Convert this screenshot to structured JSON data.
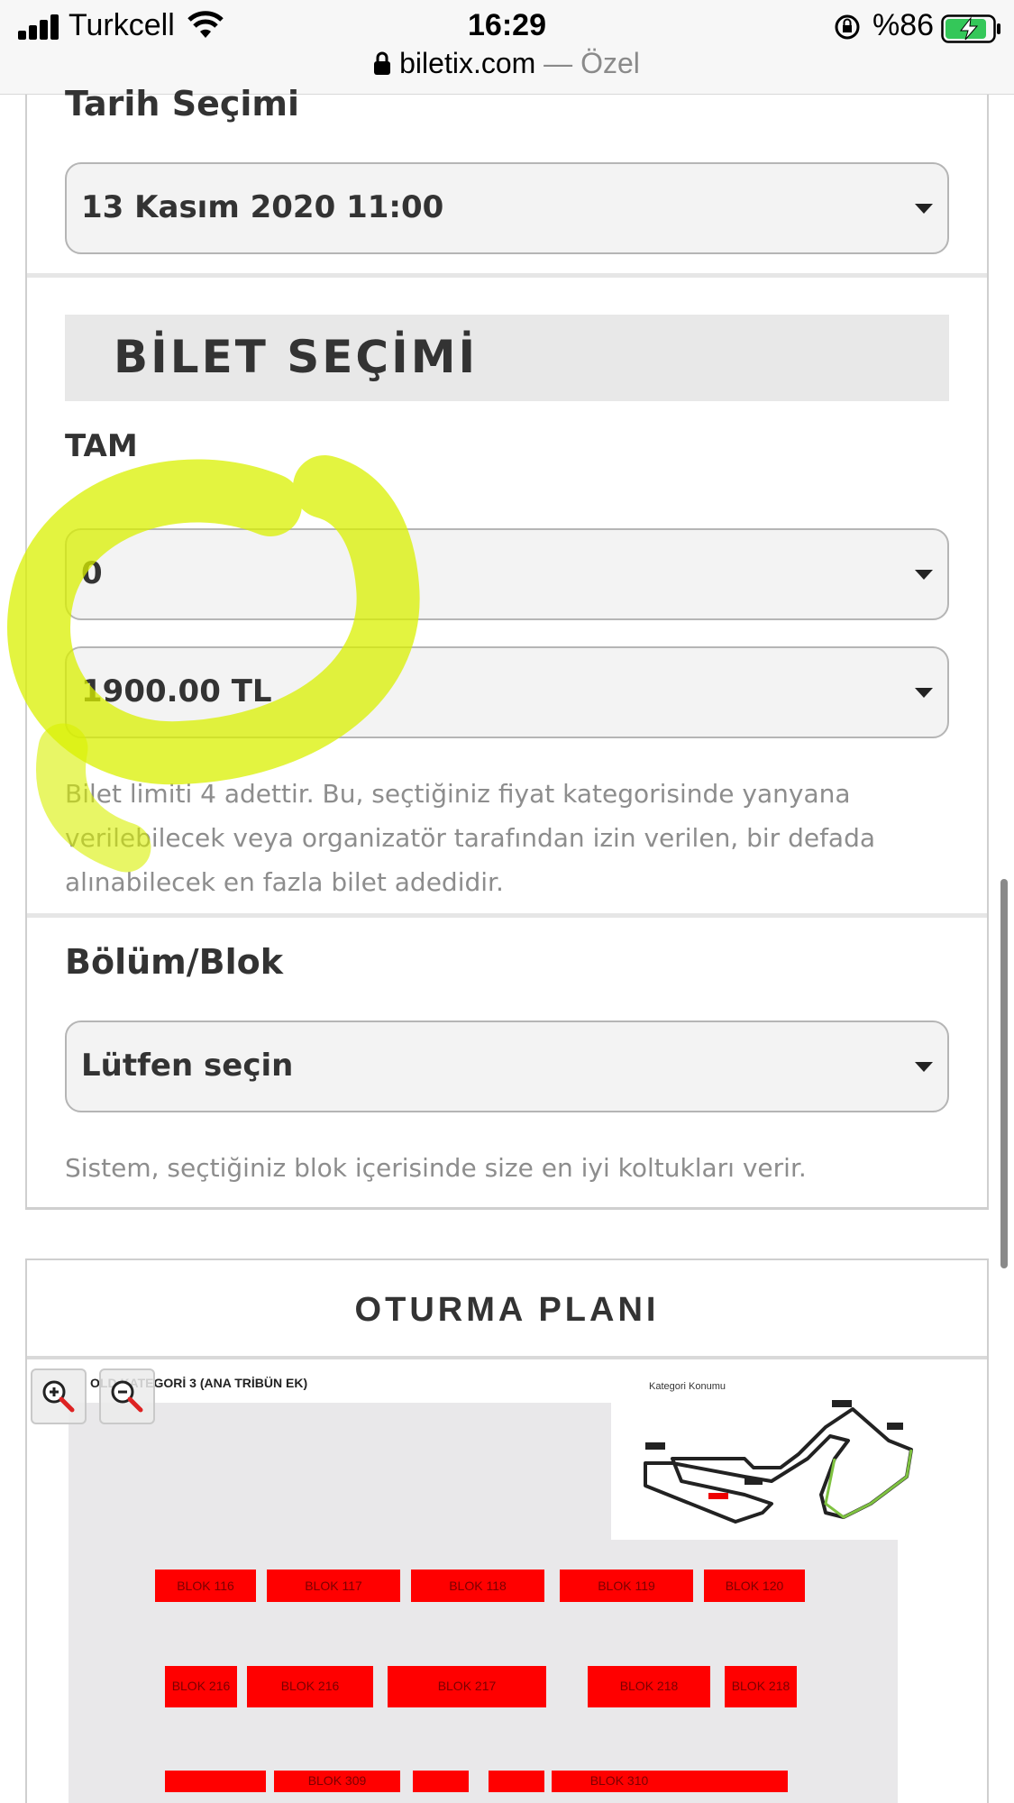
{
  "status_bar": {
    "carrier": "Turkcell",
    "time": "16:29",
    "battery_percent": "%86",
    "icons": [
      "signal-icon",
      "wifi-icon",
      "rotation-lock-icon",
      "battery-charging-icon"
    ]
  },
  "url_bar": {
    "domain": "biletix.com",
    "suffix": " — Özel"
  },
  "date_section": {
    "label": "Tarih Seçimi",
    "selected": "13 Kasım 2020 11:00"
  },
  "ticket_section": {
    "header": "BİLET SEÇİMİ",
    "category_label": "TAM",
    "quantity_selected": "0",
    "price_selected": "1900.00 TL",
    "limit_text": "Bilet limiti 4 adettir. Bu, seçtiğiniz fiyat kategorisinde yanyana verilebilecek veya organizatör tarafından izin verilen, bir defada alınabilecek en fazla bilet adedidir."
  },
  "block_section": {
    "label": "Bölüm/Blok",
    "selected": "Lütfen seçin",
    "help_text": "Sistem, seçtiğiniz blok içerisinde size en iyi koltukları verir."
  },
  "seating_plan": {
    "title": "OTURMA PLANI",
    "caption": "OLD KATEGORİ 3 (ANA TRİBÜN EK)",
    "minimap_label": "Kategori Konumu",
    "row1": [
      "BLOK 116",
      "BLOK 117",
      "BLOK 118",
      "BLOK 119",
      "BLOK 120"
    ],
    "row2": [
      "BLOK 216",
      "BLOK 216",
      "BLOK 217",
      "BLOK 218",
      "BLOK 218"
    ],
    "row3": [
      "",
      "BLOK 309",
      "",
      "",
      "BLOK 310",
      ""
    ]
  },
  "colors": {
    "block_red": "#ff0000",
    "highlighter": "#d9f000",
    "card_border": "#cfcfcf"
  }
}
